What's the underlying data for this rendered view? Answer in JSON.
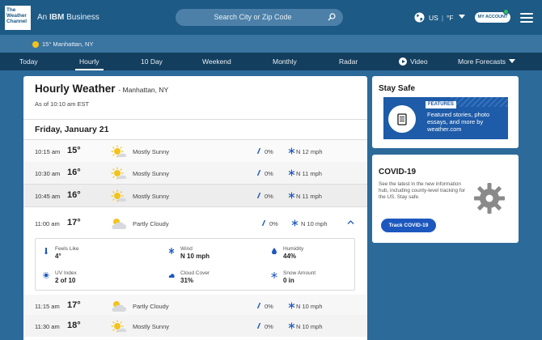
{
  "header": {
    "logo_lines": [
      "The",
      "Weather",
      "Channel"
    ],
    "ibm_prefix": "An",
    "ibm_brand": "IBM",
    "ibm_suffix": "Business",
    "search_placeholder": "Search City or Zip Code",
    "region": "US",
    "unit": "°F",
    "account_label": "MY ACCOUNT"
  },
  "location_bar": {
    "text": "15° Manhattan, NY"
  },
  "nav": {
    "tabs": [
      "Today",
      "Hourly",
      "10 Day",
      "Weekend",
      "Monthly",
      "Radar",
      "Video",
      "More Forecasts"
    ],
    "active": "Hourly"
  },
  "main": {
    "title": "Hourly Weather",
    "title_location": "- Manhattan, NY",
    "as_of": "As of 10:10 am EST",
    "day": "Friday, January 21",
    "rows": [
      {
        "time": "10:15 am",
        "temp": "15°",
        "condition": "Mostly Sunny",
        "icon": "sun-icon",
        "precip": "0%",
        "wind": "N 12 mph"
      },
      {
        "time": "10:30 am",
        "temp": "16°",
        "condition": "Mostly Sunny",
        "icon": "sun-icon",
        "precip": "0%",
        "wind": "N 11 mph"
      },
      {
        "time": "10:45 am",
        "temp": "16°",
        "condition": "Mostly Sunny",
        "icon": "sun-icon",
        "precip": "0%",
        "wind": "N 11 mph"
      },
      {
        "time": "11:00 am",
        "temp": "17°",
        "condition": "Partly Cloudy",
        "icon": "partly-cloudy-icon",
        "precip": "0%",
        "wind": "N 10 mph"
      },
      {
        "time": "11:15 am",
        "temp": "17°",
        "condition": "Partly Cloudy",
        "icon": "partly-cloudy-icon",
        "precip": "0%",
        "wind": "N 10 mph"
      },
      {
        "time": "11:30 am",
        "temp": "18°",
        "condition": "Mostly Sunny",
        "icon": "sun-icon",
        "precip": "0%",
        "wind": "N 10 mph"
      }
    ],
    "details": {
      "feels_like": {
        "label": "Feels Like",
        "value": "4°"
      },
      "wind": {
        "label": "Wind",
        "value": "N 10 mph"
      },
      "humidity": {
        "label": "Humidity",
        "value": "44%"
      },
      "uv_index": {
        "label": "UV Index",
        "value": "2 of 10"
      },
      "cloud_cover": {
        "label": "Cloud Cover",
        "value": "31%"
      },
      "snow_amount": {
        "label": "Snow Amount",
        "value": "0 in"
      }
    }
  },
  "stay_safe": {
    "title": "Stay Safe",
    "tag": "FEATURES",
    "text": "Featured stories, photo essays, and more by weather.com"
  },
  "covid": {
    "title": "COVID-19",
    "text": "See the latest in the new information hub, including county-level tracking for the US. Stay safe.",
    "button": "Track COVID-19"
  },
  "colors": {
    "header_bg": "#1d5a85",
    "nav_bg": "#143e5e",
    "page_bg": "#2c6a9a",
    "promo_bg": "#1e5ba8",
    "button_bg": "#1d58bf",
    "sun": "#f3c31a"
  }
}
